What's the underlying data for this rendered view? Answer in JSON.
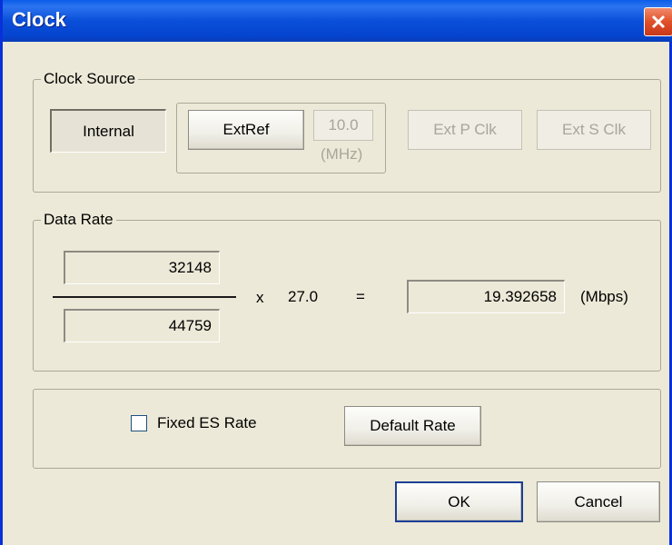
{
  "window": {
    "title": "Clock"
  },
  "clock_source": {
    "group_label": "Clock Source",
    "internal_label": "Internal",
    "extref_label": "ExtRef",
    "extref_freq_value": "10.0",
    "extref_unit": "(MHz)",
    "ext_p_clk_label": "Ext P Clk",
    "ext_s_clk_label": "Ext S Clk"
  },
  "data_rate": {
    "group_label": "Data Rate",
    "numerator": "32148",
    "denominator": "44759",
    "multiply_sign": "x",
    "multiplier": "27.0",
    "equals_sign": "=",
    "result": "19.392658",
    "unit": "(Mbps)"
  },
  "es_rate": {
    "fixed_es_rate_label": "Fixed ES Rate",
    "fixed_es_rate_checked": false,
    "default_rate_label": "Default Rate"
  },
  "buttons": {
    "ok_label": "OK",
    "cancel_label": "Cancel"
  }
}
